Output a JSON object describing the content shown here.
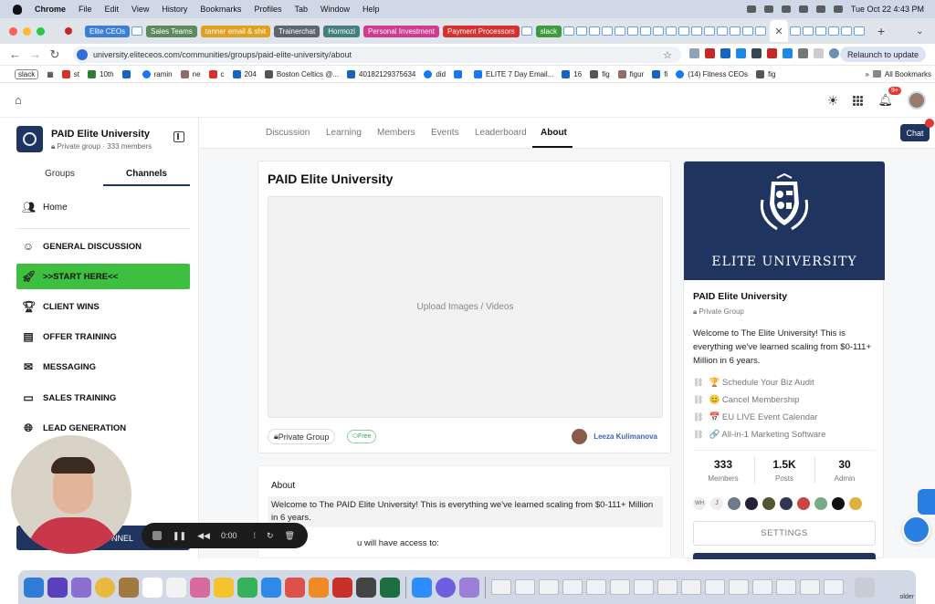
{
  "menubar": {
    "items": [
      "Chrome",
      "File",
      "Edit",
      "View",
      "History",
      "Bookmarks",
      "Profiles",
      "Tab",
      "Window",
      "Help"
    ],
    "datetime": "Tue Oct 22  4:43 PM"
  },
  "tabs": [
    {
      "label": "Elite CEOs",
      "color": "#3d7fd6"
    },
    {
      "label": "Sales Teams",
      "color": "#5c8a5c"
    },
    {
      "label": "tanner email & shit",
      "color": "#e0a020"
    },
    {
      "label": "Trainerchat",
      "color": "#5b6670"
    },
    {
      "label": "Hormozi",
      "color": "#43807d"
    },
    {
      "label": "Personal Investment",
      "color": "#d03a8f"
    },
    {
      "label": "Payment Processors",
      "color": "#d63030"
    },
    {
      "label": "slack",
      "color": "#3f9a3f"
    }
  ],
  "address": {
    "url": "university.eliteceos.com/communities/groups/paid-elite-university/about",
    "relaunch": "Relaunch to update"
  },
  "bookmarks": [
    {
      "label": "slack",
      "color": "#4a154b"
    },
    {
      "label": "st",
      "color": "#d93025"
    },
    {
      "label": "10th",
      "color": "#2e7d32"
    },
    {
      "label": "ramin",
      "color": "#1565c0"
    },
    {
      "label": "ne",
      "color": "#8d6e63"
    },
    {
      "label": "c",
      "color": "#d93025"
    },
    {
      "label": "204",
      "color": "#1565c0"
    },
    {
      "label": "Boston Celtics @...",
      "color": "#555"
    },
    {
      "label": "40182129375634",
      "color": "#1565c0"
    },
    {
      "label": "did",
      "color": "#1877f2"
    },
    {
      "label": "ELITE 7 Day Email...",
      "color": "#1877f2"
    },
    {
      "label": "16",
      "color": "#1565c0"
    },
    {
      "label": "fig",
      "color": "#555"
    },
    {
      "label": "figur",
      "color": "#8d6e63"
    },
    {
      "label": "fi",
      "color": "#1565c0"
    },
    {
      "label": "(14) Fitness CEOs",
      "color": "#1877f2"
    },
    {
      "label": "fig",
      "color": "#555"
    }
  ],
  "bookmarks_all": "All Bookmarks",
  "header": {
    "notif_count": "9+"
  },
  "sidebar": {
    "group_name": "PAID Elite University",
    "group_meta": "Private group · 333 members",
    "tabs": [
      "Groups",
      "Channels"
    ],
    "channels": [
      {
        "label": "Home",
        "icon": "people-icon"
      },
      {
        "label": "GENERAL DISCUSSION",
        "icon": "smile-icon"
      },
      {
        "label": ">>START HERE<<",
        "icon": "rocket-icon"
      },
      {
        "label": "CLIENT WINS",
        "icon": "trophy-icon"
      },
      {
        "label": "OFFER TRAINING",
        "icon": "document-icon"
      },
      {
        "label": "MESSAGING",
        "icon": "mail-icon"
      },
      {
        "label": "SALES TRAINING",
        "icon": "presentation-icon"
      },
      {
        "label": "LEAD GENERATION",
        "icon": "globe-icon"
      }
    ],
    "bottom_button": "NNEL"
  },
  "nav": {
    "tabs": [
      "Discussion",
      "Learning",
      "Members",
      "Events",
      "Leaderboard",
      "About"
    ],
    "active": "About",
    "chat": "Chat"
  },
  "post": {
    "title": "PAID Elite University",
    "upload": "Upload Images / Videos",
    "privacy": "Private Group",
    "price": "Free",
    "author": "Leeza Kulimanova"
  },
  "about": {
    "label": "About",
    "text": "Welcome to The PAID Elite University! This is everything we've learned scaling from $0-111+ Million in 6 years.",
    "text2": "u will have access to:"
  },
  "info": {
    "banner_title": "ELITE UNIVERSITY",
    "name": "PAID Elite University",
    "type": "Private Group",
    "desc": "Welcome to The Elite University! This is everything we've learned scaling from $0-111+ Million in 6 years.",
    "links": [
      "🏆 Schedule Your Biz Audit",
      "😊 Cancel Membership",
      "📅 EU LIVE Event Calendar",
      "🔗 All-in-1 Marketing Software"
    ],
    "stats": [
      {
        "value": "333",
        "label": "Members"
      },
      {
        "value": "1.5K",
        "label": "Posts"
      },
      {
        "value": "30",
        "label": "Admin"
      }
    ],
    "member_initials": [
      "WH",
      "J"
    ],
    "settings": "SETTINGS"
  },
  "recorder": {
    "time": "0:00"
  },
  "dock": {
    "folder": "older"
  }
}
